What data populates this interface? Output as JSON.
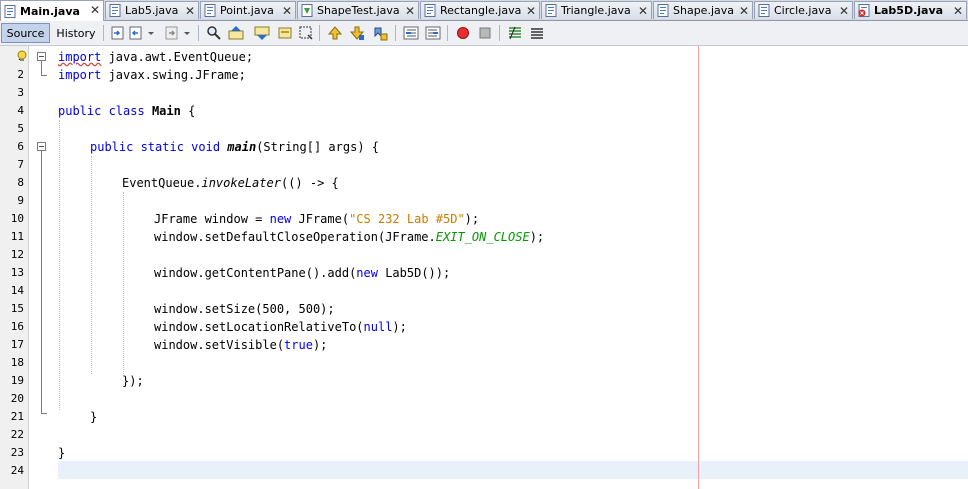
{
  "tabs": [
    {
      "label": "Main.java",
      "active": true
    },
    {
      "label": "Lab5.java",
      "active": false
    },
    {
      "label": "Point.java",
      "active": false
    },
    {
      "label": "ShapeTest.java",
      "active": false
    },
    {
      "label": "Rectangle.java",
      "active": false
    },
    {
      "label": "Triangle.java",
      "active": false
    },
    {
      "label": "Shape.java",
      "active": false
    },
    {
      "label": "Circle.java",
      "active": false
    },
    {
      "label": "Lab5D.java",
      "active": false
    }
  ],
  "tab_close_glyph": "✕",
  "toolbar": {
    "source_label": "Source",
    "history_label": "History"
  },
  "line_numbers": [
    "1",
    "2",
    "3",
    "4",
    "5",
    "6",
    "7",
    "8",
    "9",
    "10",
    "11",
    "12",
    "13",
    "14",
    "15",
    "16",
    "17",
    "18",
    "19",
    "20",
    "21",
    "22",
    "23",
    "24"
  ],
  "code": {
    "l1": {
      "kw": "import",
      "rest": " java.awt.EventQueue;"
    },
    "l2": {
      "kw": "import",
      "rest": " javax.swing.JFrame;"
    },
    "l4": {
      "kw": "public class",
      "rest": " ",
      "name": "Main",
      "end": " {"
    },
    "l6": {
      "kw": "public static void",
      "sp": " ",
      "name": "main",
      "rest": "(String[] args) {"
    },
    "l8": {
      "pre": "EventQueue.",
      "method": "invokeLater",
      "rest": "(() -> {"
    },
    "l10": {
      "pre": "JFrame window = ",
      "kw": "new",
      "mid": " JFrame(",
      "str": "\"CS 232 Lab #5D\"",
      "end": ");"
    },
    "l11": {
      "pre": "window.setDefaultCloseOperation(JFrame.",
      "fld": "EXIT_ON_CLOSE",
      "end": ");"
    },
    "l13": {
      "pre": "window.getContentPane().add(",
      "kw": "new",
      "end": " Lab5D());"
    },
    "l15": {
      "pre": "window.setSize(500, 500);"
    },
    "l16": {
      "pre": "window.setLocationRelativeTo(",
      "kw": "null",
      "end": ");"
    },
    "l17": {
      "pre": "window.setVisible(",
      "kw": "true",
      "end": ");"
    },
    "l19": {
      "pre": "});"
    },
    "l21": {
      "pre": "}"
    },
    "l23": {
      "pre": "}"
    }
  },
  "colors": {
    "keyword": "#0000e6",
    "string": "#ce7b00",
    "field": "#009900",
    "margin": "#f2a0a0",
    "current_line": "#e8f0fa"
  }
}
